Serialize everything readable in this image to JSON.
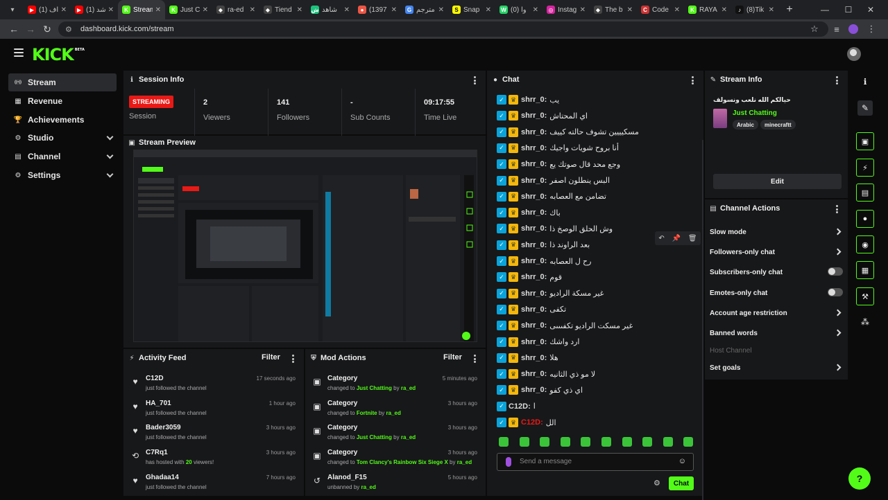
{
  "browser": {
    "tabs": [
      {
        "label": "(1) اف",
        "fav_color": "#ff0000",
        "fav": "▶"
      },
      {
        "label": "(1) شد",
        "fav_color": "#ff0000",
        "fav": "▶"
      },
      {
        "label": "Stream",
        "fav_color": "#53fc18",
        "fav": "K",
        "active": true
      },
      {
        "label": "Just C",
        "fav_color": "#53fc18",
        "fav": "K"
      },
      {
        "label": "ra-ed",
        "fav_color": "#444",
        "fav": "◆"
      },
      {
        "label": "Tiend",
        "fav_color": "#444",
        "fav": "◆"
      },
      {
        "label": "شاهد",
        "fav_color": "#1bc47d",
        "fav": "ش"
      },
      {
        "label": "(1397",
        "fav_color": "#e54",
        "fav": "●"
      },
      {
        "label": "مترجم",
        "fav_color": "#4285f4",
        "fav": "G"
      },
      {
        "label": "Snap",
        "fav_color": "#fffc00",
        "fav": "S"
      },
      {
        "label": "(0) وا",
        "fav_color": "#25d366",
        "fav": "W"
      },
      {
        "label": "Instag",
        "fav_color": "#d6249f",
        "fav": "◎"
      },
      {
        "label": "The b",
        "fav_color": "#444",
        "fav": "◆"
      },
      {
        "label": "Code",
        "fav_color": "#c33",
        "fav": "C"
      },
      {
        "label": "RAYA",
        "fav_color": "#53fc18",
        "fav": "K"
      },
      {
        "label": "(8)Tik",
        "fav_color": "#111",
        "fav": "♪"
      }
    ],
    "url": "dashboard.kick.com/stream"
  },
  "header": {
    "logo": "KICK",
    "logo_sup": "BETA"
  },
  "sidebar": {
    "items": [
      {
        "label": "Stream",
        "icon": "((•))",
        "active": true
      },
      {
        "label": "Revenue",
        "icon": "▦"
      },
      {
        "label": "Achievements",
        "icon": "🏆"
      },
      {
        "label": "Studio",
        "icon": "⚙",
        "chevron": true
      },
      {
        "label": "Channel",
        "icon": "▤",
        "chevron": true
      },
      {
        "label": "Settings",
        "icon": "⚙",
        "chevron": true
      }
    ]
  },
  "session": {
    "title": "Session Info",
    "status_badge": "STREAMING",
    "status_label": "Session",
    "stats": [
      {
        "value": "2",
        "label": "Viewers"
      },
      {
        "value": "141",
        "label": "Followers"
      },
      {
        "value": "-",
        "label": "Sub Counts"
      },
      {
        "value": "09:17:55",
        "label": "Time Live"
      }
    ]
  },
  "preview": {
    "title": "Stream Preview"
  },
  "activity": {
    "title": "Activity Feed",
    "filter": "Filter",
    "rows": [
      {
        "name": "C12D",
        "sub": "just followed the channel",
        "time": "17 seconds ago",
        "icon": "♥"
      },
      {
        "name": "HA_701",
        "sub": "just followed the channel",
        "time": "1 hour ago",
        "icon": "♥"
      },
      {
        "name": "Bader3059",
        "sub": "just followed the channel",
        "time": "3 hours ago",
        "icon": "♥"
      },
      {
        "name": "C7Rq1",
        "sub_pre": "has hosted with ",
        "sub_num": "20",
        "sub_post": " viewers!",
        "time": "3 hours ago",
        "icon": "⟲"
      },
      {
        "name": "Ghadaa14",
        "sub": "just followed the channel",
        "time": "7 hours ago",
        "icon": "♥"
      }
    ]
  },
  "mod": {
    "title": "Mod Actions",
    "filter": "Filter",
    "rows": [
      {
        "name": "Category",
        "pre": "changed to ",
        "target": "Just Chatting",
        "mid": " by ",
        "by": "ra_ed",
        "time": "5 minutes ago",
        "icon": "▣"
      },
      {
        "name": "Category",
        "pre": "changed to ",
        "target": "Fortnite",
        "mid": " by ",
        "by": "ra_ed",
        "time": "3 hours ago",
        "icon": "▣"
      },
      {
        "name": "Category",
        "pre": "changed to ",
        "target": "Just Chatting",
        "mid": " by ",
        "by": "ra_ed",
        "time": "3 hours ago",
        "icon": "▣"
      },
      {
        "name": "Category",
        "pre": "changed to ",
        "target": "Tom Clancy's Rainbow Six Siege X",
        "mid": " by ",
        "by": "ra_ed",
        "time": "3 hours ago",
        "icon": "▣"
      },
      {
        "name": "Alanod_F15",
        "pre": "unbanned by ",
        "target": "",
        "mid": "",
        "by": "ra_ed",
        "time": "5 hours ago",
        "icon": "↺"
      }
    ]
  },
  "chat": {
    "title": "Chat",
    "messages": [
      {
        "user": "shrr_0:",
        "text": "يب"
      },
      {
        "user": "shrr_0:",
        "text": "اي المحتاش"
      },
      {
        "user": "shrr_0:",
        "text": "مسكيييين تشوف حالته كييف"
      },
      {
        "user": "shrr_0:",
        "text": "أنا بروح شويات واجيك"
      },
      {
        "user": "shrr_0:",
        "text": "وجع محد قال صوتك يع"
      },
      {
        "user": "shrr_0:",
        "text": "البس ينطلون اصفر"
      },
      {
        "user": "shrr_0:",
        "text": "تضامن مع العصابه"
      },
      {
        "user": "shrr_0:",
        "text": "باك"
      },
      {
        "user": "shrr_0:",
        "text": "وش الحلق الوصخ ذا"
      },
      {
        "user": "shrr_0:",
        "text": "بعد الراوند ذا"
      },
      {
        "user": "shrr_0:",
        "text": "رح ل العصابه"
      },
      {
        "user": "shrr_0:",
        "text": "قوم"
      },
      {
        "user": "shrr_0:",
        "text": "غير مسكة الراديو"
      },
      {
        "user": "shrr_0:",
        "text": "تكفى"
      },
      {
        "user": "shrr_0:",
        "text": "غير مسكت الراديو تكفىىىى"
      },
      {
        "user": "shrr_0:",
        "text": "ارد واشك"
      },
      {
        "user": "shrr_0:",
        "text": "هلا"
      },
      {
        "user": "shrr_0:",
        "text": "لا مو ذي الثانيه"
      },
      {
        "user": "shrr_0:",
        "text": "اي ذي كفو"
      },
      {
        "user": "C12D:",
        "text": "ا",
        "plain": true
      },
      {
        "user": "C12D:",
        "text": "الل",
        "red": true
      }
    ],
    "input_placeholder": "Send a message",
    "send_label": "Chat"
  },
  "stream_info": {
    "title": "Stream Info",
    "stream_title": "حيالكم الله نلعب ونسولف",
    "category": "Just Chatting",
    "tags": [
      "Arabic",
      "minecraftt"
    ],
    "edit_label": "Edit"
  },
  "channel_actions": {
    "title": "Channel Actions",
    "items": [
      {
        "label": "Slow mode",
        "control": "arrow"
      },
      {
        "label": "Followers-only chat",
        "control": "arrow"
      },
      {
        "label": "Subscribers-only chat",
        "control": "toggle"
      },
      {
        "label": "Emotes-only chat",
        "control": "toggle"
      },
      {
        "label": "Account age restriction",
        "control": "arrow"
      },
      {
        "label": "Banned words",
        "control": "arrow"
      },
      {
        "label": "Host Channel",
        "control": "none",
        "disabled": true
      },
      {
        "label": "Set goals",
        "control": "arrow"
      }
    ]
  },
  "colors": {
    "accent": "#53fc18",
    "live": "#e91916",
    "badge_blue": "#0aa3d9",
    "badge_gold": "#f5b70c"
  }
}
